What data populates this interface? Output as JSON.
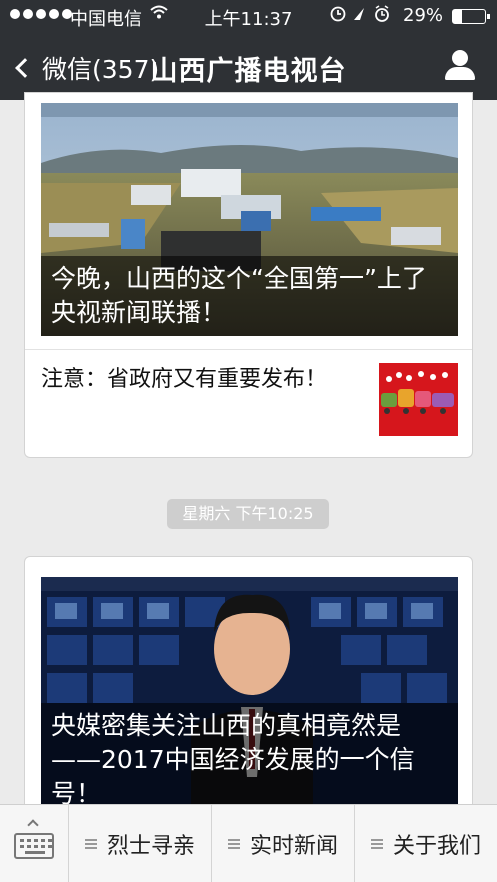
{
  "status": {
    "carrier": "中国电信",
    "time": "上午11:37",
    "battery": "29%"
  },
  "nav": {
    "back_label": "微信(357)",
    "title": "山西广播电视台"
  },
  "messages": {
    "card1": {
      "headline": "今晚，山西的这个“全国第一”上了央视新闻联播！",
      "item2": "注意：省政府又有重要发布！"
    },
    "timestamp": "星期六 下午10:25",
    "card2": {
      "headline": "央媒密集关注山西的真相竟然是——2017中国经济发展的一个信号！"
    }
  },
  "menu": {
    "items": [
      "烈士寻亲",
      "实时新闻",
      "关于我们"
    ]
  },
  "icons": {
    "back": "chevron-left-icon",
    "profile": "person-icon",
    "keyboard": "keyboard-icon",
    "menu": "hamburger-icon"
  }
}
